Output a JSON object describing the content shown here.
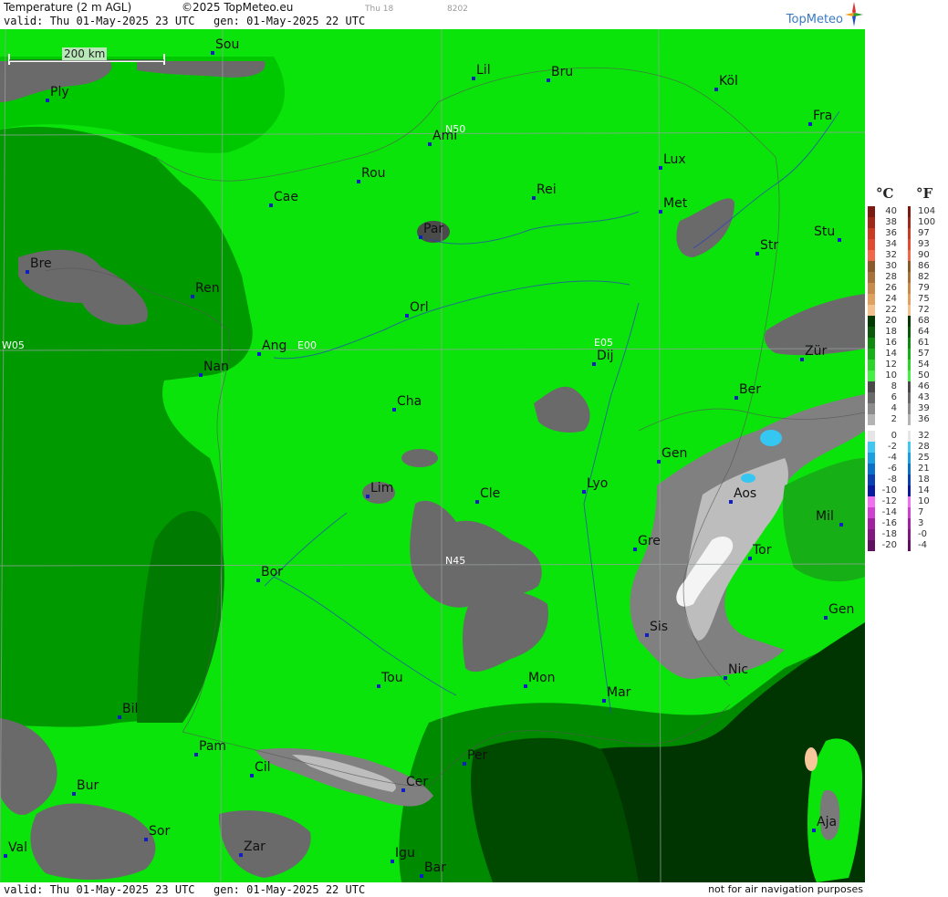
{
  "header": {
    "title": "Temperature (2 m AGL)",
    "copyright": "©2025 TopMeteo.eu",
    "day_code": "Thu 18",
    "run_code": "8202",
    "valid": "valid:  Thu  01-May-2025  23 UTC",
    "generated": "gen: 01-May-2025 22 UTC",
    "brand": "TopMeteo"
  },
  "footer": {
    "valid": "valid:  Thu  01-May-2025  23 UTC",
    "generated": "gen: 01-May-2025 22 UTC",
    "disclaimer": "not for air navigation purposes"
  },
  "map": {
    "scale_label": "200 km",
    "grid_labels": {
      "n50": "N50",
      "n45": "N45",
      "w05": "W05",
      "e00": "E00",
      "e05": "E05"
    },
    "cities": [
      {
        "name": "Sou"
      },
      {
        "name": "Ply"
      },
      {
        "name": "Lil"
      },
      {
        "name": "Bru"
      },
      {
        "name": "Köl"
      },
      {
        "name": "Ami"
      },
      {
        "name": "Fra"
      },
      {
        "name": "Lux"
      },
      {
        "name": "Rou"
      },
      {
        "name": "Cae"
      },
      {
        "name": "Rei"
      },
      {
        "name": "Met"
      },
      {
        "name": "Par"
      },
      {
        "name": "Stu"
      },
      {
        "name": "Str"
      },
      {
        "name": "Bre"
      },
      {
        "name": "Ren"
      },
      {
        "name": "Orl"
      },
      {
        "name": "Ang"
      },
      {
        "name": "Dij"
      },
      {
        "name": "Zür"
      },
      {
        "name": "Nan"
      },
      {
        "name": "Ber"
      },
      {
        "name": "Cha"
      },
      {
        "name": "Gen"
      },
      {
        "name": "Lim"
      },
      {
        "name": "Cle"
      },
      {
        "name": "Lyo"
      },
      {
        "name": "Aos"
      },
      {
        "name": "Mil"
      },
      {
        "name": "Gre"
      },
      {
        "name": "Tor"
      },
      {
        "name": "Bor"
      },
      {
        "name": "Sis"
      },
      {
        "name": "Gen"
      },
      {
        "name": "Tou"
      },
      {
        "name": "Mon"
      },
      {
        "name": "Mar"
      },
      {
        "name": "Nic"
      },
      {
        "name": "Bil"
      },
      {
        "name": "Pam"
      },
      {
        "name": "Cil"
      },
      {
        "name": "Per"
      },
      {
        "name": "Bur"
      },
      {
        "name": "Cer"
      },
      {
        "name": "Aja"
      },
      {
        "name": "Sor"
      },
      {
        "name": "Val"
      },
      {
        "name": "Zar"
      },
      {
        "name": "Igu"
      },
      {
        "name": "Bar"
      }
    ]
  },
  "legend": {
    "unit_c": "°C",
    "unit_f": "°F",
    "rows": [
      {
        "c": "40",
        "f": "104",
        "color": "#7a1a10"
      },
      {
        "c": "38",
        "f": "100",
        "color": "#a02818"
      },
      {
        "c": "36",
        "f": "97",
        "color": "#c83a22"
      },
      {
        "c": "34",
        "f": "93",
        "color": "#e04a30"
      },
      {
        "c": "32",
        "f": "90",
        "color": "#f06848"
      },
      {
        "c": "30",
        "f": "86",
        "color": "#8a5a2a"
      },
      {
        "c": "28",
        "f": "82",
        "color": "#a8703a"
      },
      {
        "c": "26",
        "f": "79",
        "color": "#c88a4a"
      },
      {
        "c": "24",
        "f": "75",
        "color": "#e0a060"
      },
      {
        "c": "22",
        "f": "72",
        "color": "#f4c08c"
      },
      {
        "c": "20",
        "f": "68",
        "color": "#003a00"
      },
      {
        "c": "18",
        "f": "64",
        "color": "#0a5a0a"
      },
      {
        "c": "16",
        "f": "61",
        "color": "#0f8a0f"
      },
      {
        "c": "14",
        "f": "57",
        "color": "#16b016"
      },
      {
        "c": "12",
        "f": "54",
        "color": "#2ad42a"
      },
      {
        "c": "10",
        "f": "50",
        "color": "#44f044"
      },
      {
        "c": "8",
        "f": "46",
        "color": "#4a4a4a"
      },
      {
        "c": "6",
        "f": "43",
        "color": "#6a6a6a"
      },
      {
        "c": "4",
        "f": "39",
        "color": "#8c8c8c"
      },
      {
        "c": "2",
        "f": "36",
        "color": "#b4b4b4"
      },
      {
        "c": "0",
        "f": "32",
        "color": "#e6e6e6"
      },
      {
        "c": "-2",
        "f": "28",
        "color": "#40c8f0"
      },
      {
        "c": "-4",
        "f": "25",
        "color": "#1aa0e0"
      },
      {
        "c": "-6",
        "f": "21",
        "color": "#0a70c8"
      },
      {
        "c": "-8",
        "f": "18",
        "color": "#0a40b0"
      },
      {
        "c": "-10",
        "f": "14",
        "color": "#0a1aa0"
      },
      {
        "c": "-12",
        "f": "10",
        "color": "#f070f0"
      },
      {
        "c": "-14",
        "f": "7",
        "color": "#d040d0"
      },
      {
        "c": "-16",
        "f": "3",
        "color": "#a020a0"
      },
      {
        "c": "-18",
        "f": "-0",
        "color": "#801880"
      },
      {
        "c": "-20",
        "f": "-4",
        "color": "#601060"
      }
    ]
  },
  "colors": {
    "bright_green": "#0ae40a",
    "mid_green": "#00c800",
    "sea_green": "#009a00",
    "dark_green": "#006400",
    "very_dark_green": "#003400",
    "grey_dark": "#4b4b4b",
    "grey_mid": "#808080",
    "grey_light": "#bdbdbd",
    "snow": "#f4f4f4",
    "ice": "#36c6f2",
    "peach": "#f5c79a",
    "city_marker": "#1020c0"
  }
}
